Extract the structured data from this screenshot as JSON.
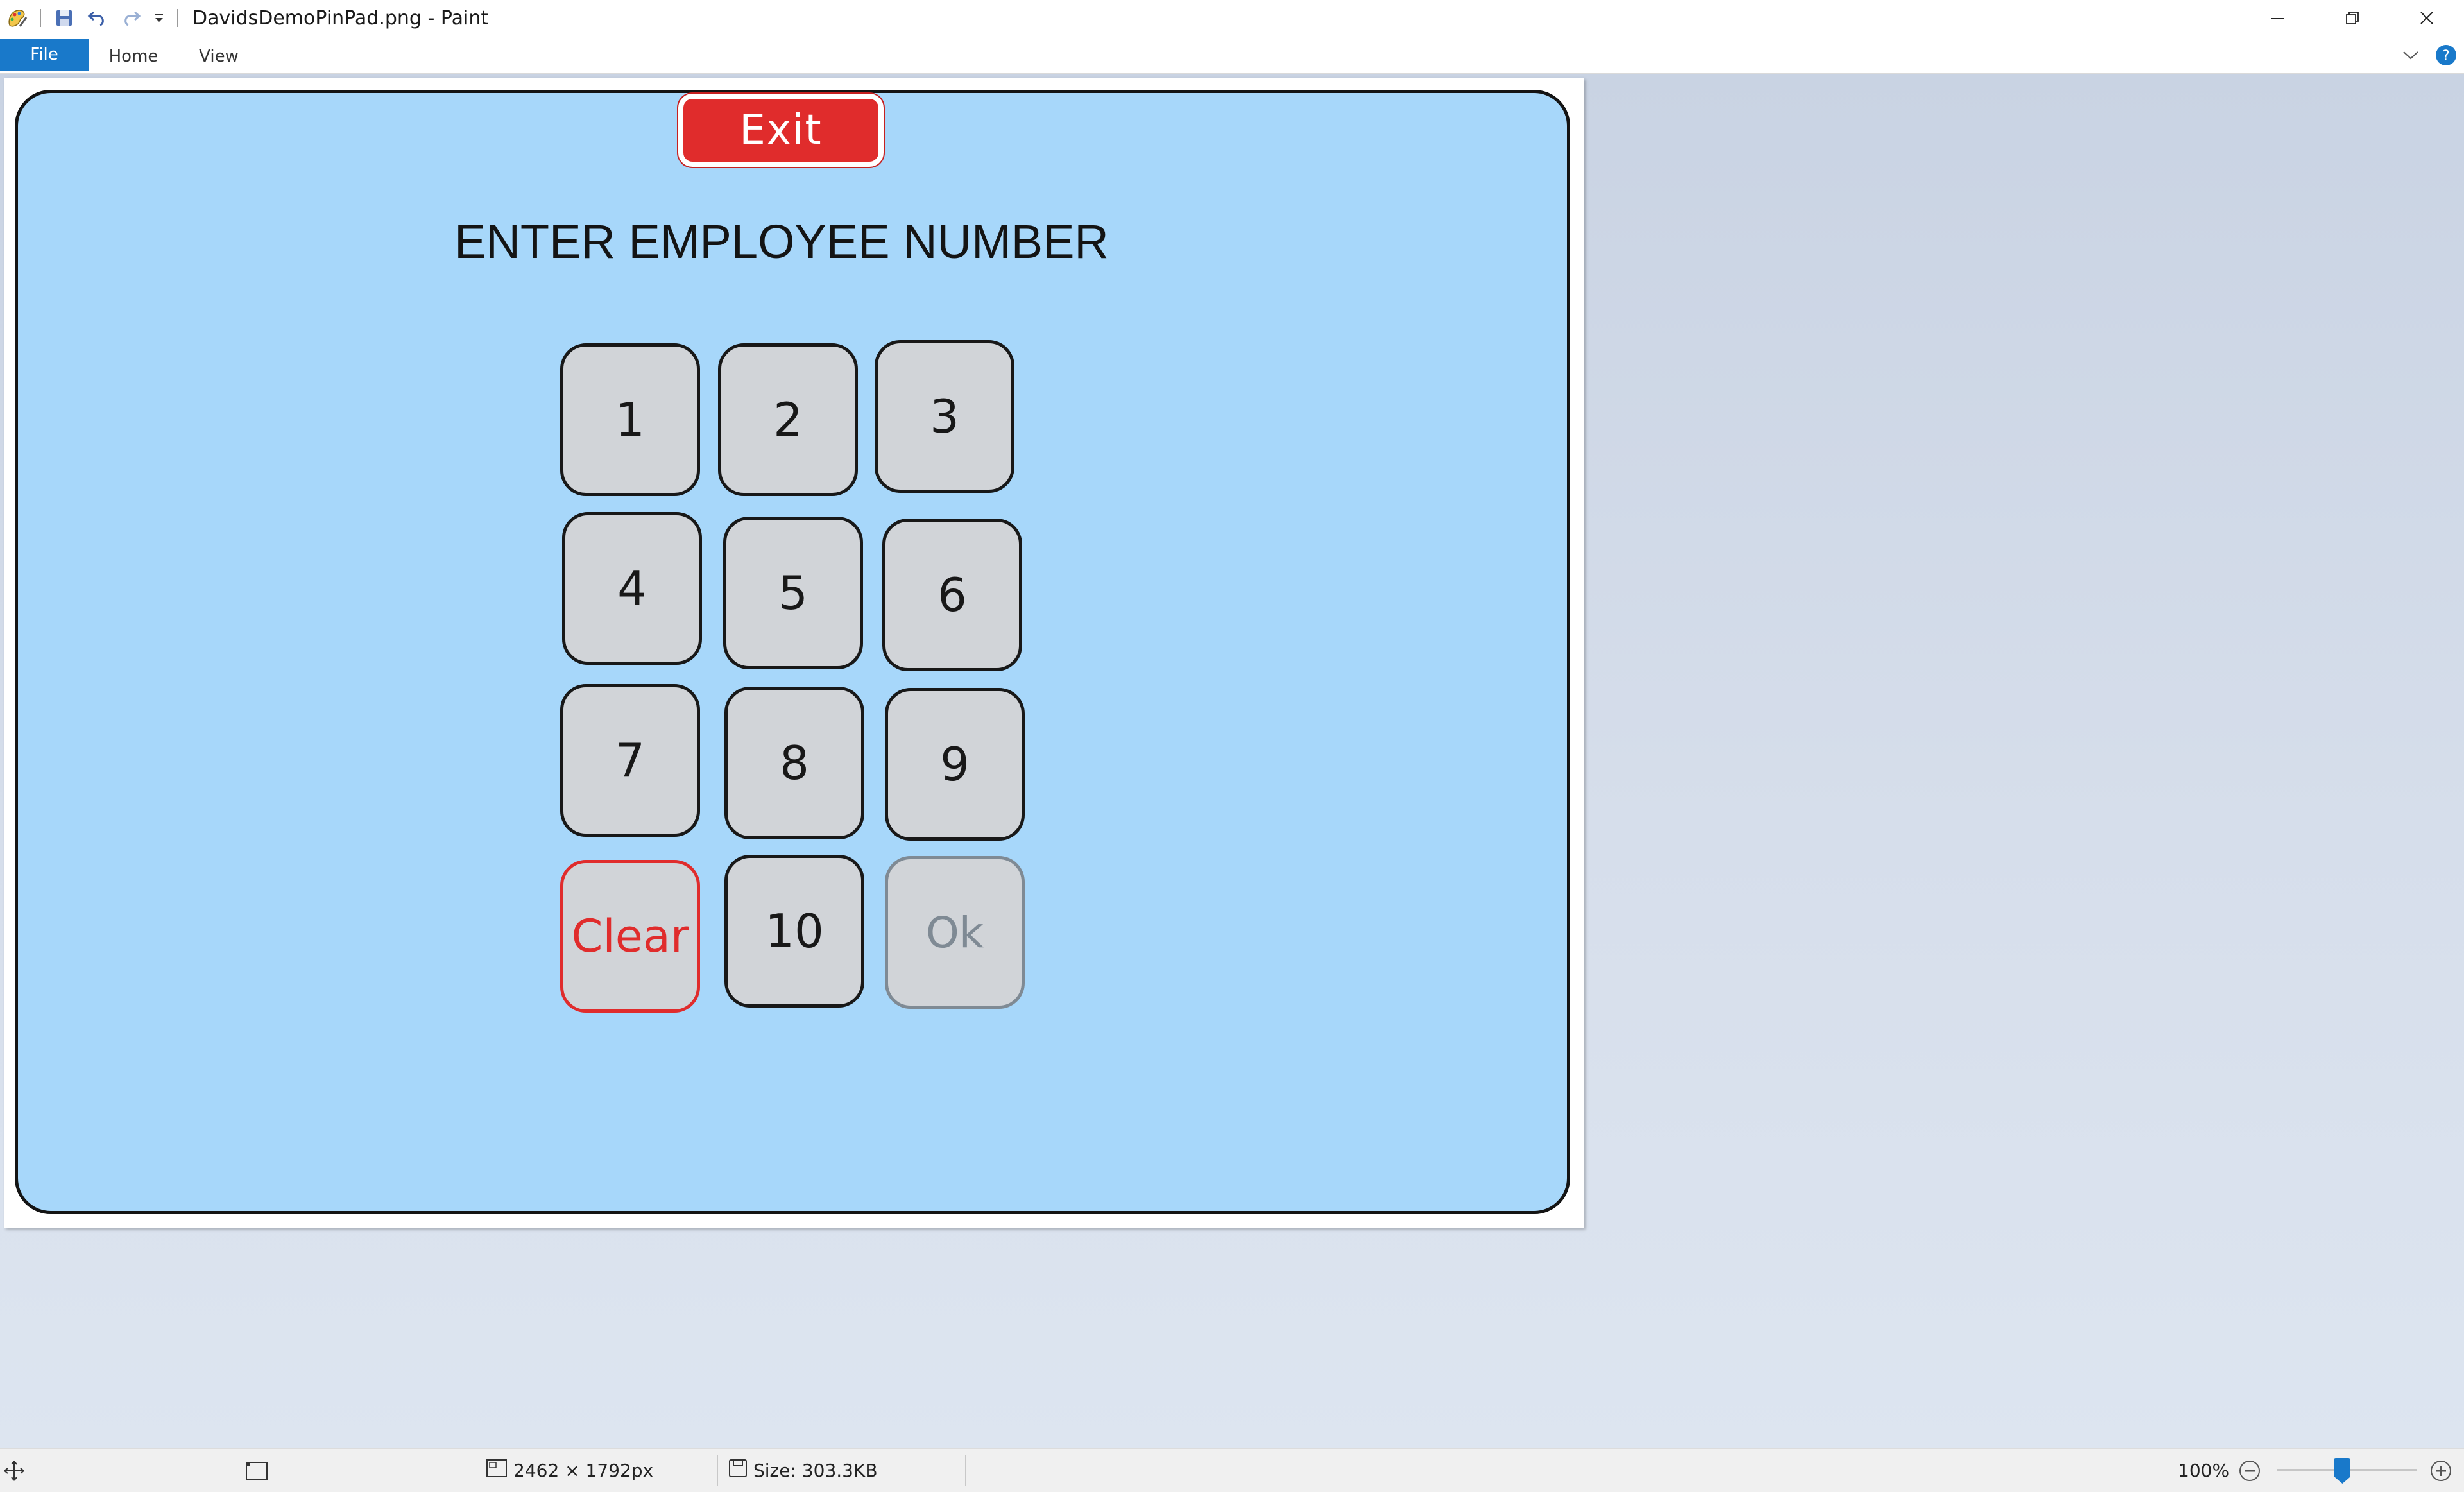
{
  "window": {
    "title": "DavidsDemoPinPad.png - Paint"
  },
  "ribbon": {
    "tabs": [
      "File",
      "Home",
      "View"
    ]
  },
  "canvas": {
    "exit_label": "Exit",
    "heading": "ENTER EMPLOYEE NUMBER",
    "keys": [
      "1",
      "2",
      "3",
      "4",
      "5",
      "6",
      "7",
      "8",
      "9",
      "Clear",
      "10",
      "Ok"
    ]
  },
  "statusbar": {
    "dimensions": "2462 × 1792px",
    "size": "Size: 303.3KB",
    "zoom": "100%",
    "zoom_fraction": 0.47
  },
  "colors": {
    "accent": "#1979ca",
    "panel_bg": "#a7d7fa",
    "exit_red": "#e02c2c",
    "key_gray": "#d1d4d8",
    "ok_disabled": "#7f8a94"
  },
  "icons": {
    "paint_app": "paint-app-icon",
    "save": "save-icon",
    "undo": "undo-icon",
    "redo": "redo-icon",
    "customize": "customize-qat-icon",
    "minimize": "minimize-icon",
    "restore": "restore-icon",
    "close": "close-icon",
    "collapse_ribbon": "chevron-down-icon",
    "help": "help-icon",
    "selection": "selection-move-icon",
    "canvas_select": "canvas-size-icon",
    "image_size": "image-size-icon",
    "file_size": "disk-icon",
    "zoom_out": "zoom-out-icon",
    "zoom_in": "zoom-in-icon"
  }
}
